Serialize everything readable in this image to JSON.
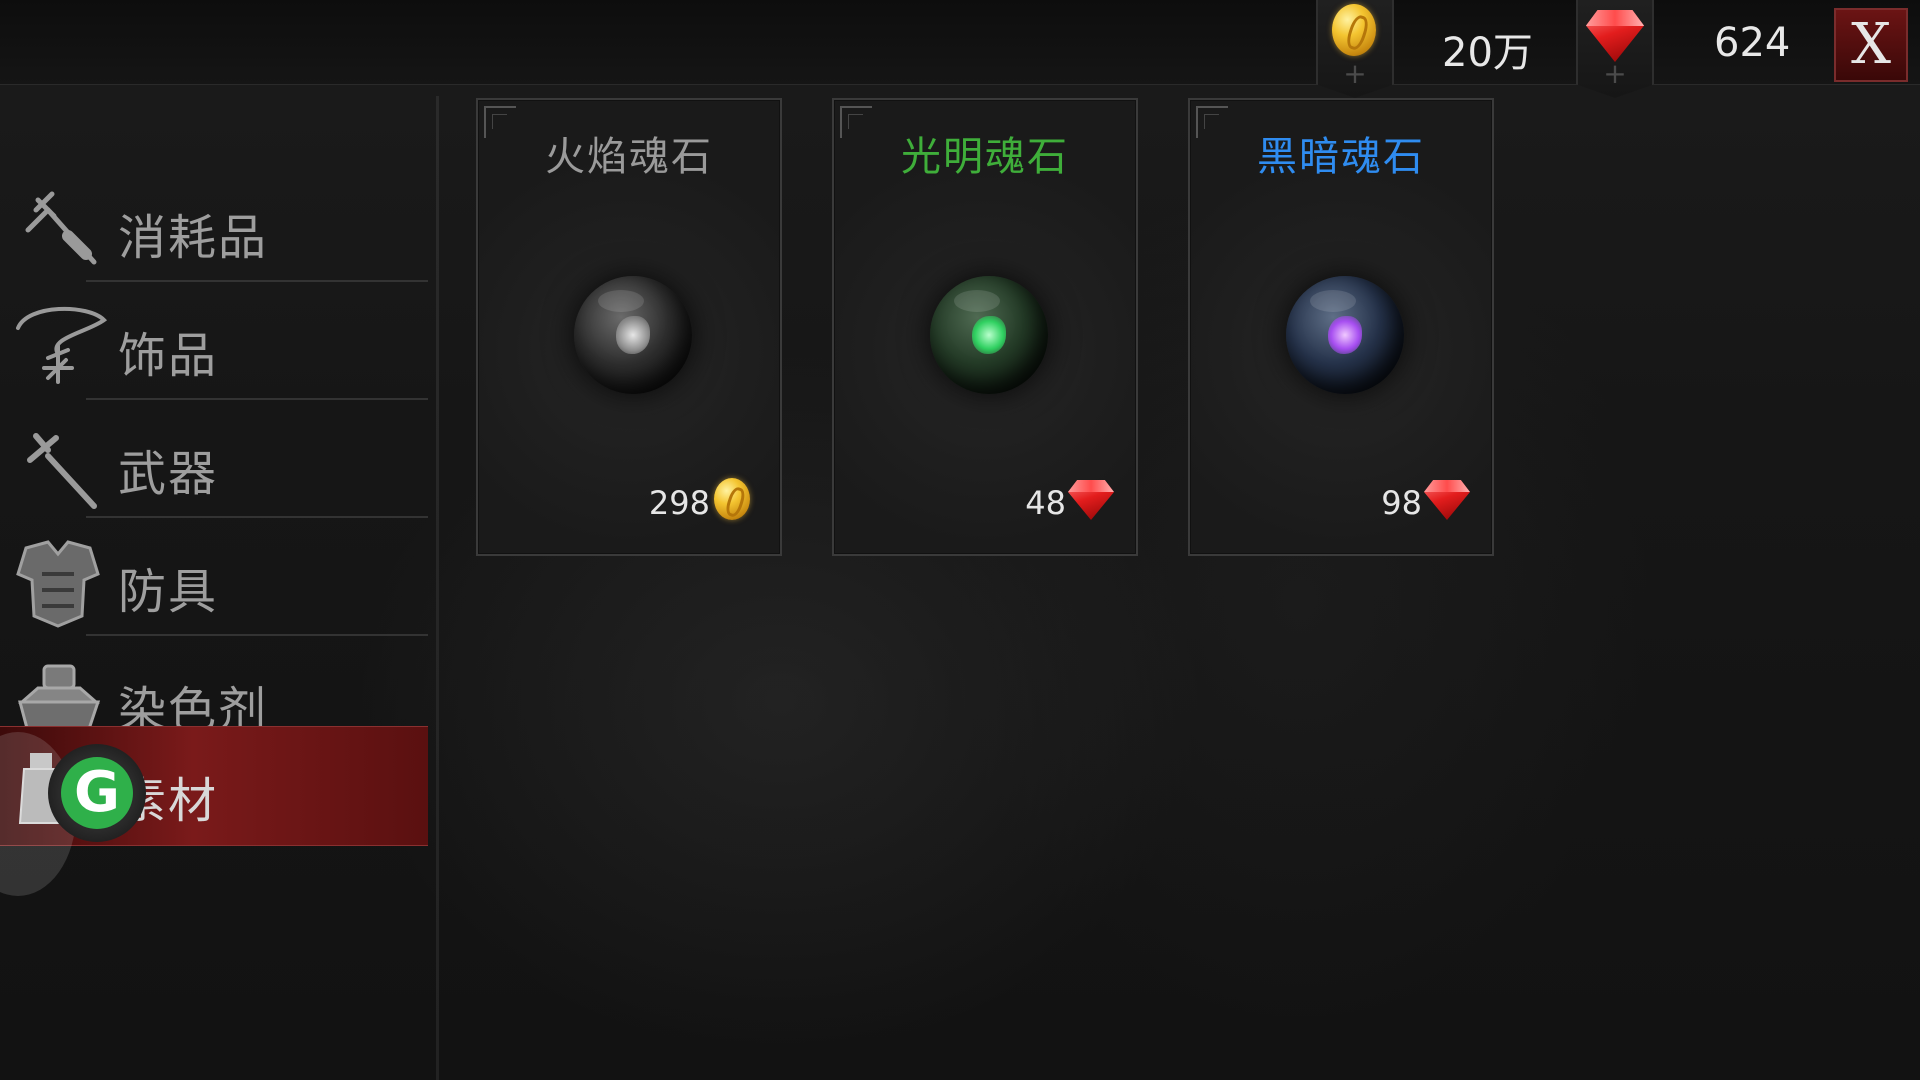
{
  "topbar": {
    "gold_icon": "gold-coin-icon",
    "gold_amount": "20万",
    "gem_icon": "red-gem-icon",
    "gem_amount": "624",
    "add_symbol": "+",
    "close_label": "X"
  },
  "sidebar": {
    "items": [
      {
        "label": "消耗品",
        "icon": "potion-vial-icon",
        "active": false
      },
      {
        "label": "饰品",
        "icon": "necklace-icon",
        "active": false
      },
      {
        "label": "武器",
        "icon": "sword-icon",
        "active": false
      },
      {
        "label": "防具",
        "icon": "armor-icon",
        "active": false
      },
      {
        "label": "染色剂",
        "icon": "dye-pot-icon",
        "active": false
      },
      {
        "label": "素材",
        "icon": "material-jar-icon",
        "active": true
      }
    ],
    "badge_letter": "G"
  },
  "shop": {
    "items": [
      {
        "name": "火焰魂石",
        "name_color": "#9a9a9a",
        "price": "298",
        "currency": "gold-coin-icon",
        "orb_tint": "#9a9a9a"
      },
      {
        "name": "光明魂石",
        "name_color": "#3fae3a",
        "price": "48",
        "currency": "red-gem-icon",
        "orb_tint": "#3bd26a"
      },
      {
        "name": "黑暗魂石",
        "name_color": "#2f8cf0",
        "price": "98",
        "currency": "red-gem-icon",
        "orb_tint": "#a64df0"
      }
    ]
  }
}
